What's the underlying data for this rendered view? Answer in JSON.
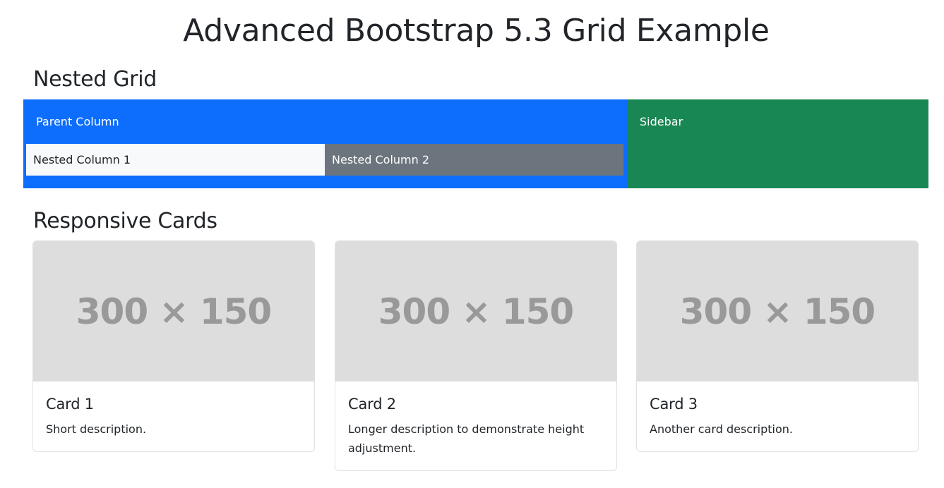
{
  "page": {
    "title": "Advanced Bootstrap 5.3 Grid Example"
  },
  "nested_grid": {
    "heading": "Nested Grid",
    "parent_label": "Parent Column",
    "nested_columns": [
      "Nested Column 1",
      "Nested Column 2"
    ],
    "sidebar_label": "Sidebar"
  },
  "responsive_cards": {
    "heading": "Responsive Cards",
    "cards": [
      {
        "image_text": "300 × 150",
        "title": "Card 1",
        "text": "Short description."
      },
      {
        "image_text": "300 × 150",
        "title": "Card 2",
        "text": "Longer description to demonstrate height adjustment."
      },
      {
        "image_text": "300 × 150",
        "title": "Card 3",
        "text": "Another card description."
      }
    ]
  },
  "colors": {
    "primary": "#0d6efd",
    "success": "#198754",
    "light": "#f8f9fa",
    "secondary": "#6c757d",
    "placeholder_bg": "#dddddd",
    "placeholder_text": "#999999"
  }
}
